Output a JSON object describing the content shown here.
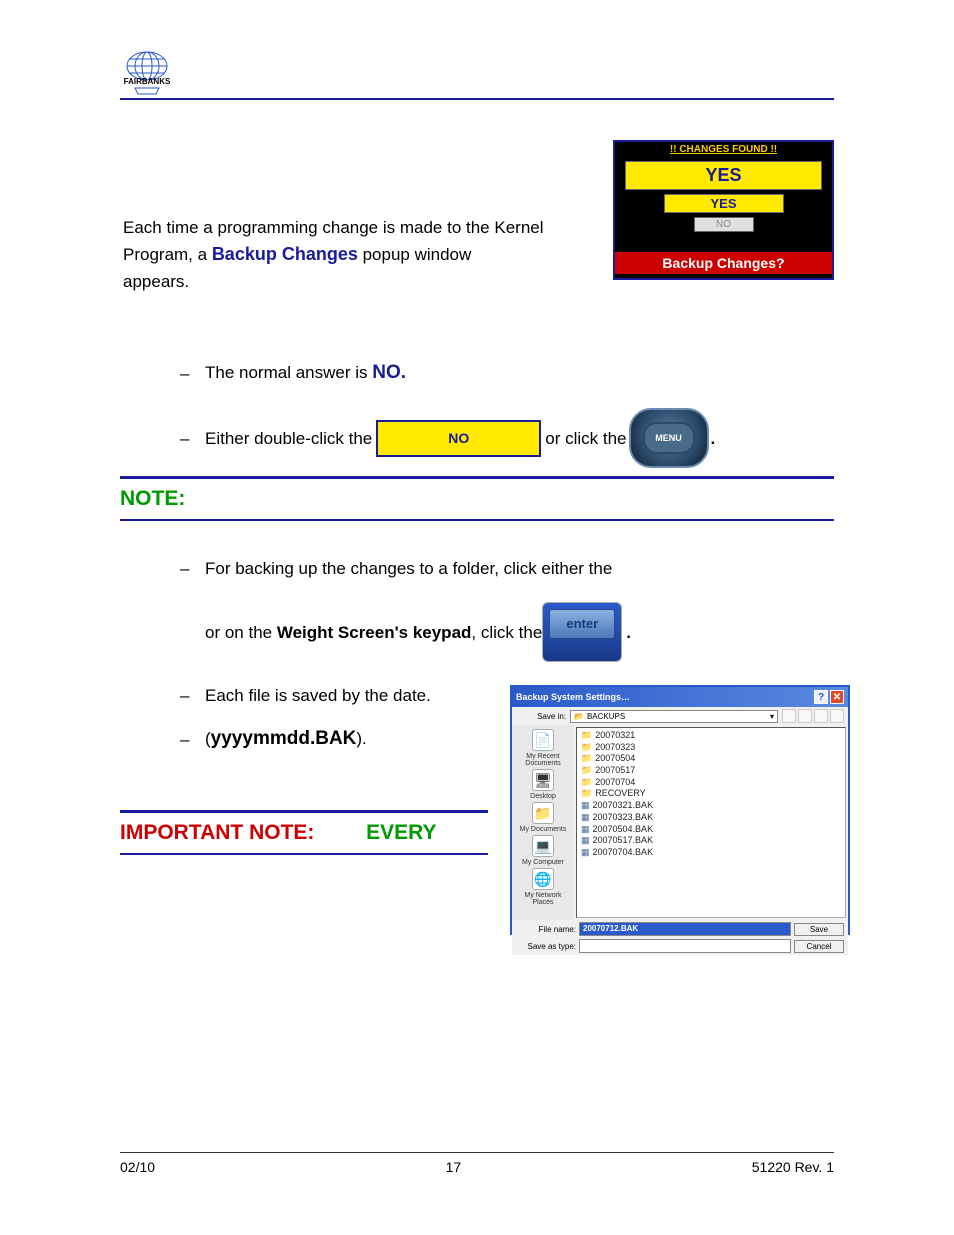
{
  "header": {
    "brand": "FAIRBANKS"
  },
  "intro": {
    "line1": "Each time a programming change is made to the Kernel",
    "line2_pre": "Program, a ",
    "line2_bold": "Backup Changes",
    "line2_post": " popup window",
    "line3": "appears."
  },
  "popup": {
    "title": "!! CHANGES FOUND !!",
    "yes_big": "YES",
    "yes_med": "YES",
    "no": "NO",
    "footer": "Backup Changes?"
  },
  "bullets1": {
    "b1_pre": "The normal answer is ",
    "b1_bold": "NO.",
    "b2_pre": "Either double-click the ",
    "b2_no": "NO",
    "b2_mid": " or click the ",
    "b2_menu": "MENU",
    "b2_end": "."
  },
  "note_heading": "NOTE:",
  "bullets2": {
    "b1": "For backing up the changes to a folder, click  either the",
    "b2_pre": "or on the ",
    "b2_bold": "Weight Screen's keypad",
    "b2_post": ", click  the ",
    "b2_enter": "enter",
    "b2_end": ".",
    "b3": "Each file is saved by the date.",
    "b4_pre": "(",
    "b4_bold": "yyyymmdd.BAK",
    "b4_post": ")."
  },
  "important": {
    "red": "IMPORTANT NOTE:",
    "green": "EVERY"
  },
  "dialog": {
    "title": "Backup System Settings…",
    "savein_label": "Save in:",
    "savein_value": "BACKUPS",
    "sidebar": [
      {
        "icon": "📄",
        "label": "My Recent Documents"
      },
      {
        "icon": "🖥",
        "label": "Desktop"
      },
      {
        "icon": "📁",
        "label": "My Documents"
      },
      {
        "icon": "💻",
        "label": "My Computer"
      },
      {
        "icon": "🌐",
        "label": "My Network Places"
      }
    ],
    "folders": [
      "20070321",
      "20070323",
      "20070504",
      "20070517",
      "20070704",
      "RECOVERY"
    ],
    "files": [
      "20070321.BAK",
      "20070323.BAK",
      "20070504.BAK",
      "20070517.BAK",
      "20070704.BAK"
    ],
    "filename_label": "File name:",
    "filename_value": "20070712.BAK",
    "type_label": "Save as type:",
    "save_btn": "Save",
    "cancel_btn": "Cancel"
  },
  "footer": {
    "left": "02/10",
    "center": "17",
    "right": "51220   Rev. 1"
  }
}
